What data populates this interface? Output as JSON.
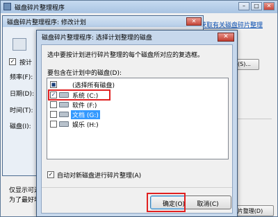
{
  "w1": {
    "title": "磁盘碎片整理程序",
    "text_partial": "能。",
    "link": "获取有关磁盘碎片整理",
    "btn_s": "(S)...",
    "bottom1": "仅显示可进",
    "bottom2": "为了最好地确",
    "btn_d": "片整理(D)"
  },
  "w2": {
    "title": "磁盘碎片整理程序: 修改计划",
    "check": "按计",
    "labels": [
      "频率(F):",
      "日期(D):",
      "时间(T):",
      "磁盘(I):"
    ]
  },
  "dialog": {
    "title": "磁盘碎片整理程序: 选择计划整理的磁盘",
    "description": "选中要按计划进行碎片整理的每个磁盘所对应的复选框。",
    "list_label": "要包含在计划中的磁盘(D):",
    "items": [
      {
        "label": "(选择所有磁盘)",
        "checked": "partial"
      },
      {
        "label": "系统 (C:)",
        "checked": true
      },
      {
        "label": "软件 (F:)",
        "checked": false
      },
      {
        "label": "文档 (G:)",
        "checked": false
      },
      {
        "label": "娱乐 (H:)",
        "checked": false
      }
    ],
    "auto_label": "自动对新磁盘进行碎片整理(A)",
    "ok": "确定(O)",
    "cancel": "取消(C)",
    "close": "✕"
  }
}
